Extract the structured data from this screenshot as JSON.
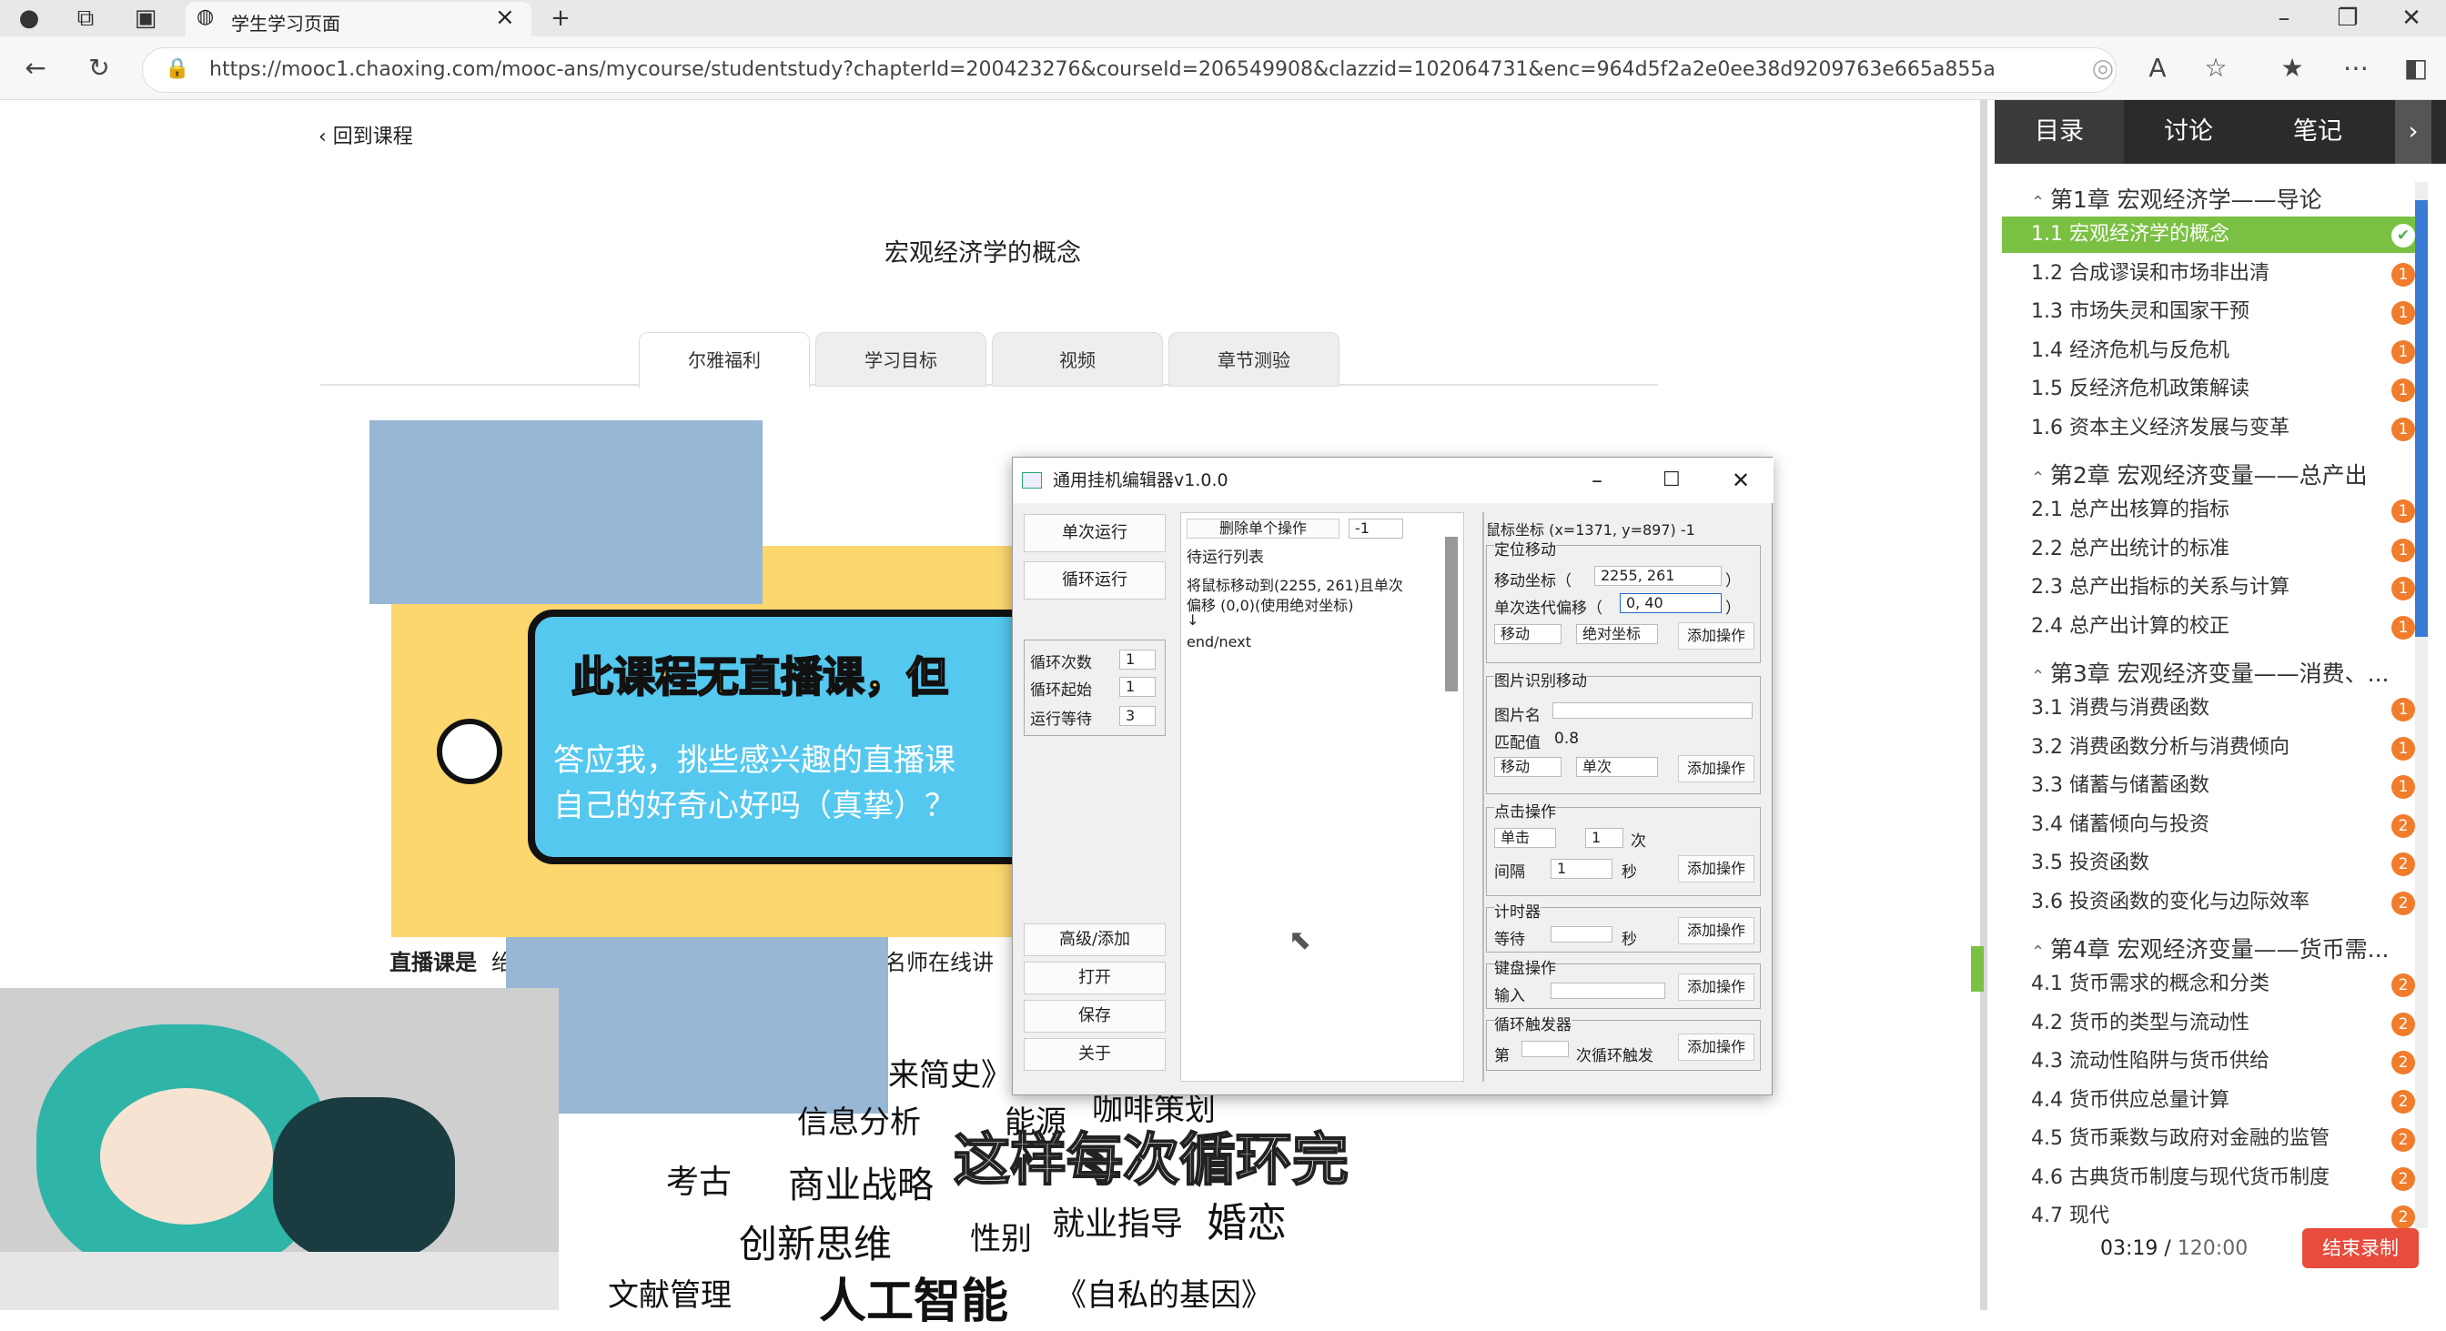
{
  "browser": {
    "tab_title": "学生学习页面",
    "url": "https://mooc1.chaoxing.com/mooc-ans/mycourse/studentstudy?chapterId=200423276&courseId=206549908&clazzid=102064731&enc=964d5f2a2e0ee38d9209763e665a855a"
  },
  "page": {
    "back": "回到课程",
    "title": "宏观经济学的概念",
    "tabs": [
      "尔雅福利",
      "学习目标",
      "视频",
      "章节测验"
    ],
    "banner_title": "此课程无直播课，但",
    "banner_line1": "答应我，挑些感兴趣的直播课",
    "banner_line2": "自己的好奇心好吗（真挚）？",
    "live_prefix": "直播课是",
    "live_tail1": "绐",
    "live_tail2": "名师在线讲",
    "words": [
      "来简史》",
      "信息分析",
      "能源",
      "咖啡策划",
      "考古",
      "商业战略",
      "婚恋",
      "创新思维",
      "性别",
      "就业指导",
      "文献管理",
      "人工智能",
      "《自私的基因》"
    ]
  },
  "subtitle": "这样每次循环完",
  "editor": {
    "title": "通用挂机编辑器v1.0.0",
    "run_once": "单次运行",
    "run_loop": "循环运行",
    "loop_count_label": "循环次数",
    "loop_count": "1",
    "loop_start_label": "循环起始",
    "loop_start": "1",
    "wait_label": "运行等待",
    "wait": "3",
    "advanced": "高级/添加",
    "open": "打开",
    "save": "保存",
    "about": "关于",
    "delete_label": "删除单个操作",
    "delete_value": "-1",
    "list_title": "待运行列表",
    "list_line1": "将鼠标移动到(2255, 261)且单次",
    "list_line2": "偏移 (0,0)(使用绝对坐标)",
    "list_arrow": "↓",
    "list_end": "end/next",
    "mouse_coord": "鼠标坐标 (x=1371, y=897) -1",
    "pos_move": "定位移动",
    "move_coord_label": "移动坐标（",
    "move_coord": "2255, 261",
    "paren": "）",
    "offset_label": "单次迭代偏移（",
    "offset": "0, 40",
    "move": "移动",
    "abs_coord": "绝对坐标",
    "add": "添加操作",
    "img_move": "图片识别移动",
    "img_name": "图片名",
    "match_label": "匹配值",
    "match": "0.8",
    "single": "单次",
    "click_op": "点击操作",
    "click": "单击",
    "times_val": "1",
    "times": "次",
    "interval": "间隔",
    "interval_val": "1",
    "sec": "秒",
    "timer": "计时器",
    "wait2": "等待",
    "key_op": "键盘操作",
    "input": "输入",
    "loop_trigger": "循环触发器",
    "nth": "第",
    "nth_tail": "次循环触发"
  },
  "sidebar": {
    "tabs": [
      "目录",
      "讨论",
      "笔记"
    ],
    "chapters": [
      {
        "title": "第1章 宏观经济学——导论",
        "items": [
          [
            "1.1 宏观经济学的概念",
            "✔"
          ],
          [
            "1.2 合成谬误和市场非出清",
            "1"
          ],
          [
            "1.3 市场失灵和国家干预",
            "1"
          ],
          [
            "1.4 经济危机与反危机",
            "1"
          ],
          [
            "1.5 反经济危机政策解读",
            "1"
          ],
          [
            "1.6 资本主义经济发展与变革",
            "1"
          ]
        ]
      },
      {
        "title": "第2章 宏观经济变量——总产出",
        "items": [
          [
            "2.1 总产出核算的指标",
            "1"
          ],
          [
            "2.2 总产出统计的标准",
            "1"
          ],
          [
            "2.3 总产出指标的关系与计算",
            "1"
          ],
          [
            "2.4 总产出计算的校正",
            "1"
          ]
        ]
      },
      {
        "title": "第3章 宏观经济变量——消费、...",
        "items": [
          [
            "3.1 消费与消费函数",
            "1"
          ],
          [
            "3.2 消费函数分析与消费倾向",
            "1"
          ],
          [
            "3.3 储蓄与储蓄函数",
            "1"
          ],
          [
            "3.4 储蓄倾向与投资",
            "2"
          ],
          [
            "3.5 投资函数",
            "2"
          ],
          [
            "3.6 投资函数的变化与边际效率",
            "2"
          ]
        ]
      },
      {
        "title": "第4章 宏观经济变量——货币需...",
        "items": [
          [
            "4.1 货币需求的概念和分类",
            "2"
          ],
          [
            "4.2 货币的类型与流动性",
            "2"
          ],
          [
            "4.3 流动性陷阱与货币供给",
            "2"
          ],
          [
            "4.4 货币供应总量计算",
            "2"
          ],
          [
            "4.5 货币乘数与政府对金融的监管",
            "2"
          ],
          [
            "4.6 古典货币制度与现代货币制度",
            "2"
          ],
          [
            "4.7 现代",
            "2"
          ]
        ]
      }
    ]
  },
  "recording": {
    "time": "03:19",
    "total": "120:00",
    "end": "结束录制"
  }
}
